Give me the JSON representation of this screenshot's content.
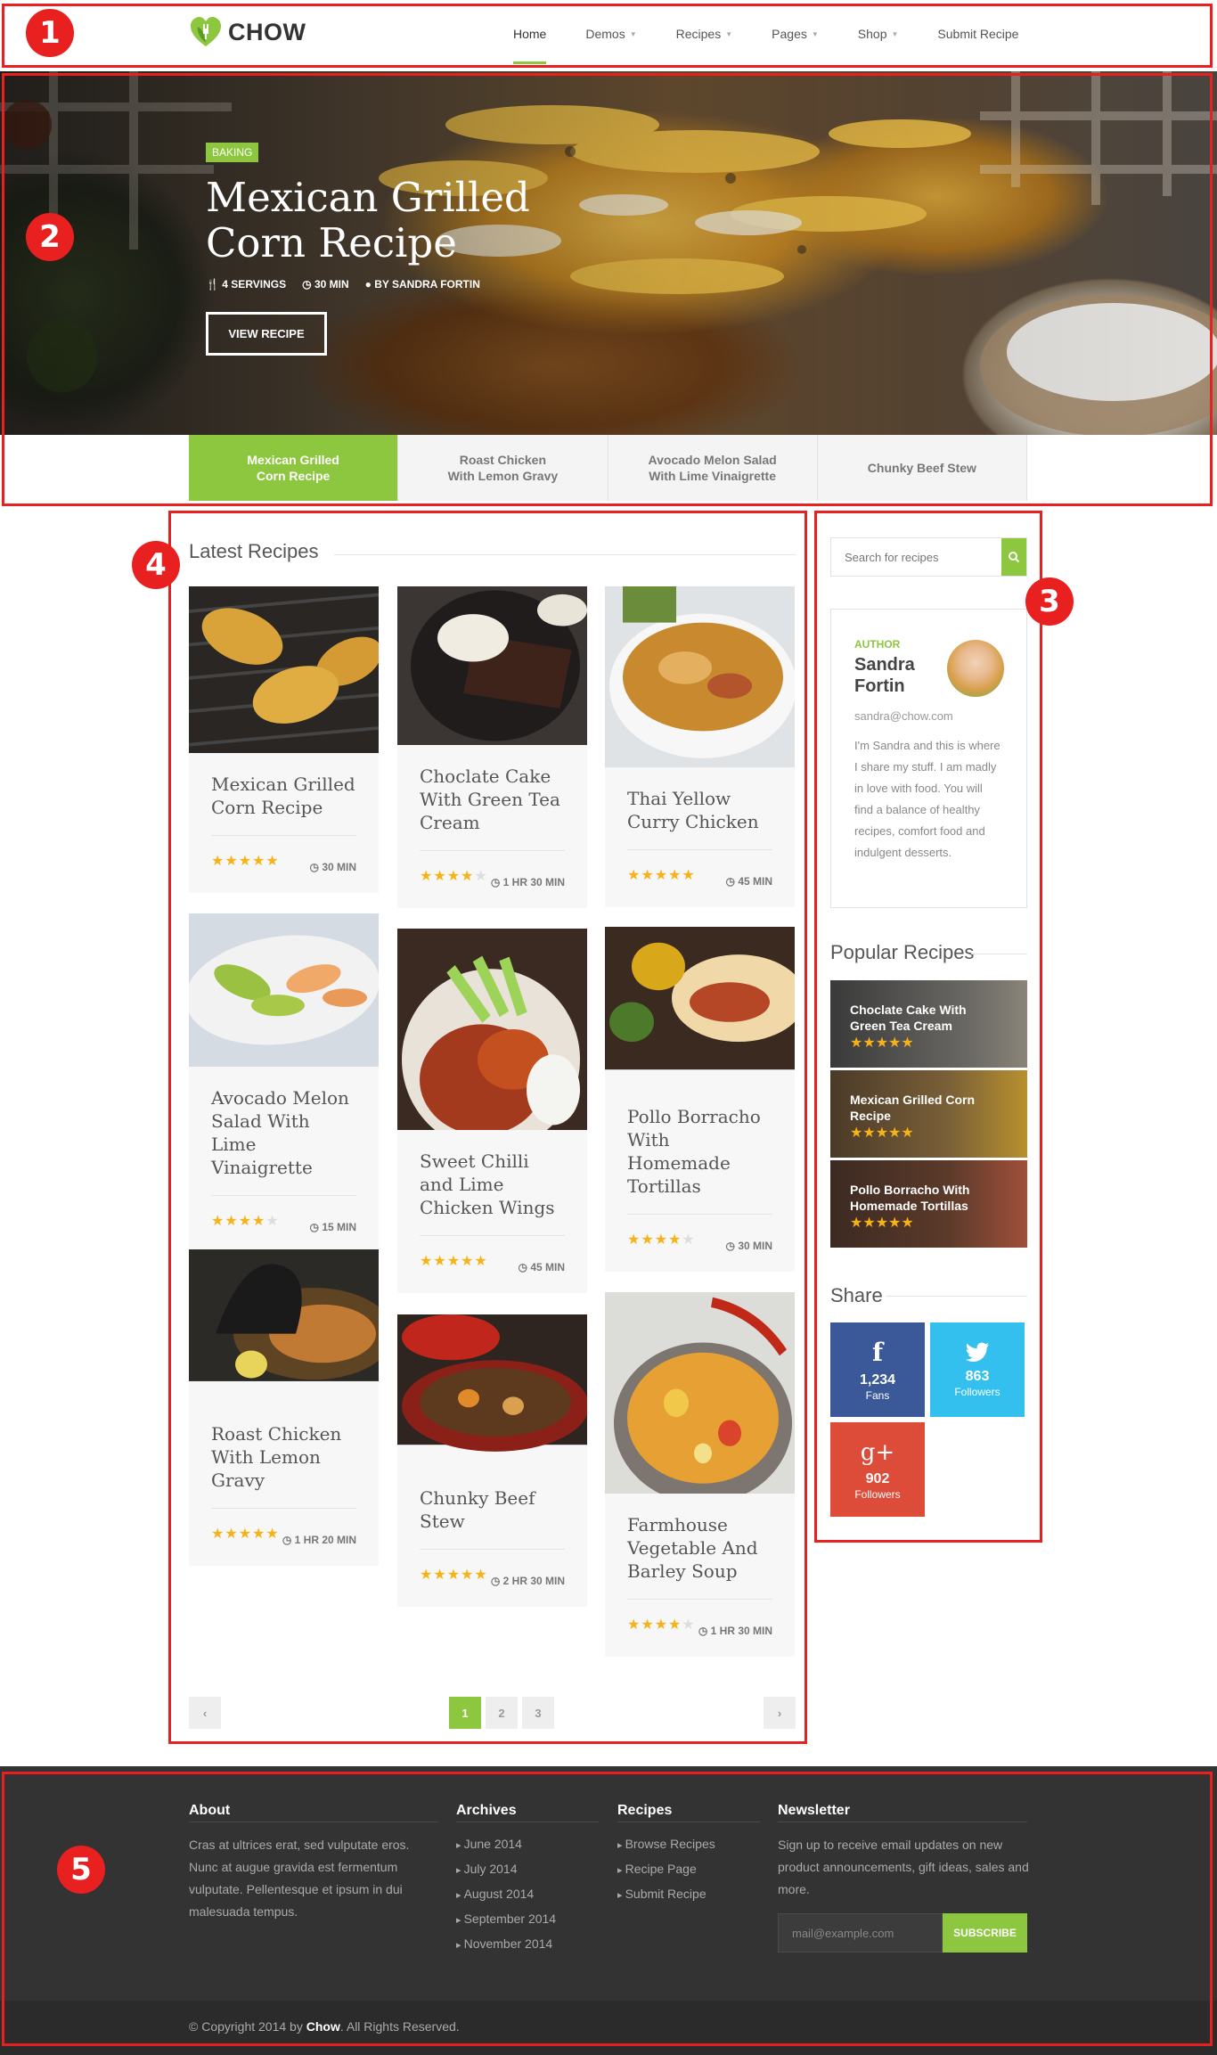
{
  "header": {
    "logo_text": "CHOW",
    "nav": [
      {
        "label": "Home",
        "active": true,
        "dropdown": false
      },
      {
        "label": "Demos",
        "dropdown": true
      },
      {
        "label": "Recipes",
        "dropdown": true
      },
      {
        "label": "Pages",
        "dropdown": true
      },
      {
        "label": "Shop",
        "dropdown": true
      },
      {
        "label": "Submit Recipe",
        "dropdown": false
      }
    ]
  },
  "hero": {
    "tag": "BAKING",
    "title": "Mexican Grilled Corn Recipe",
    "servings": "4 SERVINGS",
    "time": "30 MIN",
    "author": "BY SANDRA FORTIN",
    "button": "VIEW RECIPE"
  },
  "slider_tabs": [
    "Mexican Grilled\nCorn Recipe",
    "Roast Chicken\nWith Lemon Gravy",
    "Avocado Melon Salad\nWith Lime Vinaigrette",
    "Chunky Beef Stew"
  ],
  "latest": {
    "title": "Latest Recipes",
    "cards": [
      {
        "title": "Mexican Grilled Corn Recipe",
        "rating": 5,
        "time": "30 MIN",
        "image": "grilled-corn"
      },
      {
        "title": "Choclate Cake With Green Tea Cream",
        "rating": 4,
        "time": "1 HR 30 MIN",
        "image": "chocolate-cake"
      },
      {
        "title": "Thai Yellow Curry Chicken",
        "rating": 5,
        "time": "45 MIN",
        "image": "curry"
      },
      {
        "title": "Avocado Melon Salad With Lime Vinaigrette",
        "rating": 4,
        "time": "15 MIN",
        "image": "salad"
      },
      {
        "title": "Sweet Chilli and Lime Chicken Wings",
        "rating": 5,
        "time": "45 MIN",
        "image": "wings"
      },
      {
        "title": "Pollo Borracho With Homemade Tortillas",
        "rating": 4,
        "time": "30 MIN",
        "image": "tortillas"
      },
      {
        "title": "Roast Chicken With Lemon Gravy",
        "rating": 5,
        "time": "1 HR 20 MIN",
        "image": "tagine"
      },
      {
        "title": "Chunky Beef Stew",
        "rating": 5,
        "time": "2 HR 30 MIN",
        "image": "stew"
      },
      {
        "title": "Farmhouse Vegetable And Barley Soup",
        "rating": 4,
        "time": "1 HR 30 MIN",
        "image": "soup"
      }
    ],
    "pages": [
      "1",
      "2",
      "3"
    ]
  },
  "sidebar": {
    "search_placeholder": "Search for recipes",
    "author": {
      "label": "AUTHOR",
      "name": "Sandra Fortin",
      "email": "sandra@chow.com",
      "bio": "I'm Sandra and this is where I share my stuff. I am madly in love with food. You will find a balance of healthy recipes, comfort food and indulgent desserts."
    },
    "popular_title": "Popular Recipes",
    "popular": [
      {
        "title": "Choclate Cake With Green Tea Cream",
        "rating": 5
      },
      {
        "title": "Mexican Grilled Corn Recipe",
        "rating": 5
      },
      {
        "title": "Pollo Borracho With Homemade Tortillas",
        "rating": 5
      }
    ],
    "share_title": "Share",
    "share": [
      {
        "network": "facebook",
        "count": "1,234",
        "label": "Fans",
        "color": "#3b5998"
      },
      {
        "network": "twitter",
        "count": "863",
        "label": "Followers",
        "color": "#33c0ee"
      },
      {
        "network": "google-plus",
        "count": "902",
        "label": "Followers",
        "color": "#dd4b39"
      }
    ]
  },
  "footer": {
    "about_title": "About",
    "about_text": "Cras at ultrices erat, sed vulputate eros. Nunc at augue gravida est fermentum vulputate. Pellentesque et ipsum in dui malesuada tempus.",
    "archives_title": "Archives",
    "archives": [
      "June 2014",
      "July 2014",
      "August 2014",
      "September 2014",
      "November 2014"
    ],
    "recipes_title": "Recipes",
    "recipes": [
      "Browse Recipes",
      "Recipe Page",
      "Submit Recipe"
    ],
    "newsletter_title": "Newsletter",
    "newsletter_text": "Sign up to receive email updates on new product announcements, gift ideas, sales and more.",
    "newsletter_placeholder": "mail@example.com",
    "subscribe": "SUBSCRIBE",
    "copyright_prefix": "© Copyright 2014 by ",
    "copyright_brand": "Chow",
    "copyright_suffix": ". All Rights Reserved."
  },
  "annotations": [
    "1",
    "2",
    "3",
    "4",
    "5"
  ],
  "colors": {
    "accent": "#8dc63f",
    "annotation": "#e8201f",
    "star": "#f7b219",
    "footer": "#333333"
  }
}
